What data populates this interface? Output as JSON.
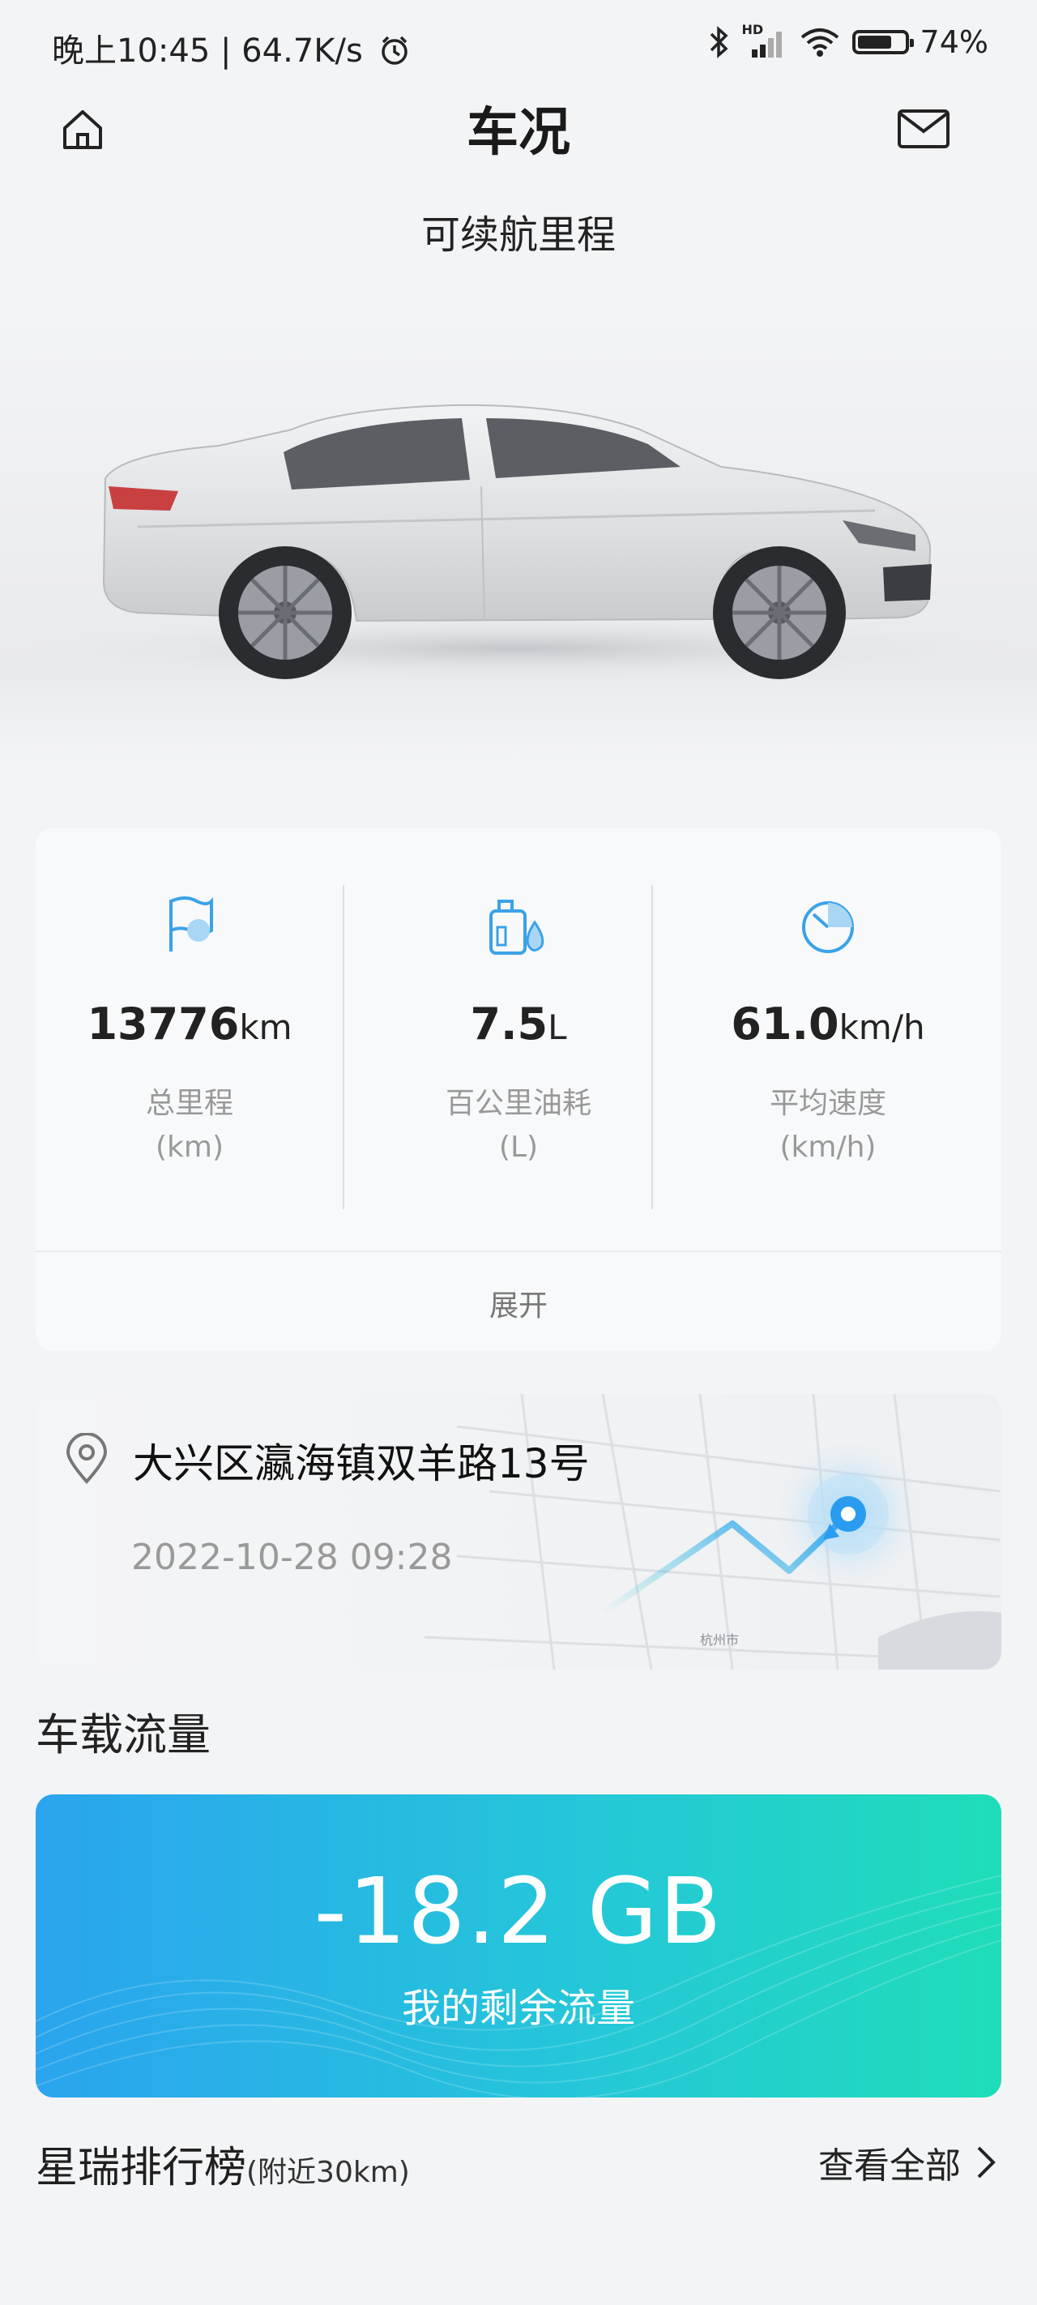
{
  "status_bar": {
    "time_net": "晚上10:45 | 64.7K/s",
    "net_type": "HD",
    "battery_level": 0.74,
    "battery": "74%"
  },
  "header": {
    "title": "车况",
    "home_icon": "home-icon",
    "mail_icon": "mail-icon"
  },
  "range": {
    "label": "可续航里程"
  },
  "stats": [
    {
      "value": "13776",
      "unit": "km",
      "label": "总里程",
      "sub": "(km)",
      "icon": "flag-icon"
    },
    {
      "value": "7.5",
      "unit": "L",
      "label": "百公里油耗",
      "sub": "(L)",
      "icon": "fuel-icon"
    },
    {
      "value": "61.0",
      "unit": "km/h",
      "label": "平均速度",
      "sub": "(km/h)",
      "icon": "speedometer-icon"
    }
  ],
  "expand_label": "展开",
  "location": {
    "address": "大兴区瀛海镇双羊路13号",
    "timestamp": "2022-10-28  09:28",
    "map_label": "杭州市"
  },
  "data_section": {
    "title": "车载流量",
    "value": "-18.2 GB",
    "label": "我的剩余流量"
  },
  "ranking": {
    "title": "星瑞排行榜",
    "subtitle": "(附近30km)",
    "more": "查看全部"
  },
  "colors": {
    "accent_blue": "#3aa2e8",
    "gradient_start": "#2aa4ee",
    "gradient_end": "#1fddb8"
  }
}
